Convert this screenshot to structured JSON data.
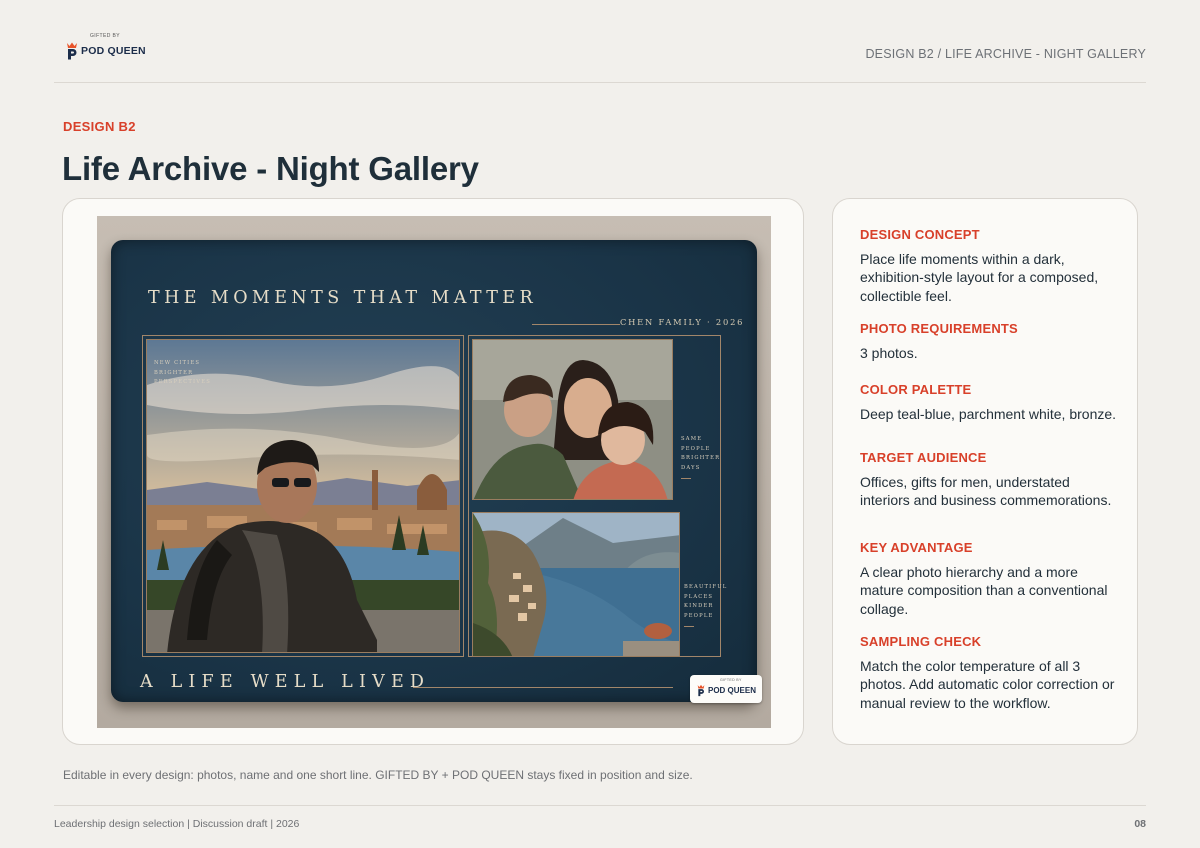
{
  "header": {
    "logo_gifted": "GIFTED BY",
    "logo_brand": "POD QUEEN",
    "breadcrumb": "DESIGN B2 / LIFE ARCHIVE - NIGHT GALLERY"
  },
  "page": {
    "kicker": "DESIGN B2",
    "title": "Life Archive - Night Gallery"
  },
  "mockup": {
    "headline": "THE MOMENTS THAT MATTER",
    "family": "CHEN FAMILY · 2026",
    "captions": [
      [
        "NEW CITIES",
        "BRIGHTER",
        "PERSPECTIVES"
      ],
      [
        "SAME",
        "PEOPLE",
        "BRIGHTER",
        "DAYS"
      ],
      [
        "BEAUTIFUL",
        "PLACES",
        "KINDER",
        "PEOPLE"
      ]
    ],
    "footer_line": "A LIFE WELL LIVED",
    "badge_gifted": "GIFTED BY",
    "badge_brand": "POD QUEEN",
    "colors": {
      "blanket": "#1a3447",
      "bronze": "#a2866a",
      "parchment": "#e6ddc8"
    },
    "photos": [
      "man-overlooking-florence",
      "mother-with-two-children",
      "amalfi-coast-village"
    ]
  },
  "sections": [
    {
      "heading": "DESIGN CONCEPT",
      "body": "Place life moments within a dark, exhibition-style layout for a composed, collectible feel."
    },
    {
      "heading": "PHOTO REQUIREMENTS",
      "body": "3 photos."
    },
    {
      "heading": "COLOR PALETTE",
      "body": "Deep teal-blue, parchment white, bronze."
    },
    {
      "heading": "TARGET AUDIENCE",
      "body": "Offices, gifts for men, understated interiors and business commemorations."
    },
    {
      "heading": "KEY ADVANTAGE",
      "body": "A clear photo hierarchy and a more mature composition than a conventional collage."
    },
    {
      "heading": "SAMPLING CHECK",
      "body": "Match the color temperature of all 3 photos. Add automatic color correction or manual review to the workflow."
    }
  ],
  "footnote": "Editable in every design: photos, name and one short line. GIFTED BY + POD QUEEN stays fixed in position and size.",
  "footer": {
    "left": "Leadership design selection | Discussion draft | 2026",
    "page_number": "08"
  },
  "accent_color": "#d8402a"
}
